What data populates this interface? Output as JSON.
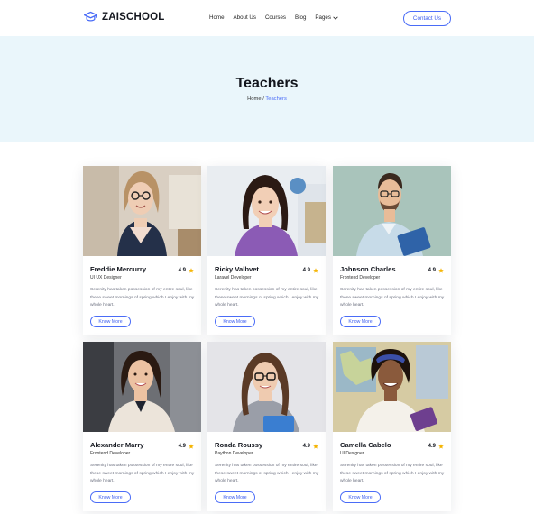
{
  "brand": {
    "name": "ZAISCHOOL",
    "accent": "#4a6cf7"
  },
  "nav": {
    "items": [
      "Home",
      "About Us",
      "Courses",
      "Blog",
      "Pages"
    ],
    "contact_label": "Contact Us"
  },
  "banner": {
    "title": "Teachers",
    "breadcrumb_home": "Home",
    "breadcrumb_sep": " / ",
    "breadcrumb_current": "Teachers",
    "bg": "#eaf6fb"
  },
  "teachers": [
    {
      "name": "Freddie Mercurry",
      "role": "UI UX Designer",
      "rating": "4.9",
      "desc": "Serenity has taken possession of my entire soul, like these sweet mornings of spring which I enjoy with my whole heart.",
      "button": "Know More"
    },
    {
      "name": "Ricky Valbvet",
      "role": "Laravel Developer",
      "rating": "4.9",
      "desc": "Serenity has taken possession of my entire soul, like these sweet mornings of spring which I enjoy with my whole heart.",
      "button": "Know More"
    },
    {
      "name": "Johnson Charles",
      "role": "Frontend Developer",
      "rating": "4.9",
      "desc": "Serenity has taken possession of my entire soul, like these sweet mornings of spring which I enjoy with my whole heart.",
      "button": "Know More"
    },
    {
      "name": "Alexander Marry",
      "role": "Frontend Developer",
      "rating": "4.9",
      "desc": "Serenity has taken possession of my entire soul, like these sweet mornings of spring which I enjoy with my whole heart.",
      "button": "Know More"
    },
    {
      "name": "Ronda Roussy",
      "role": "Paython Developer",
      "rating": "4.9",
      "desc": "Serenity has taken possession of my entire soul, like these sweet mornings of spring which I enjoy with my whole heart.",
      "button": "Know More"
    },
    {
      "name": "Camella Cabelo",
      "role": "UI Designer",
      "rating": "4.9",
      "desc": "Serenity has taken possession of my entire soul, like these sweet mornings of spring which I enjoy with my whole heart.",
      "button": "Know More"
    }
  ]
}
